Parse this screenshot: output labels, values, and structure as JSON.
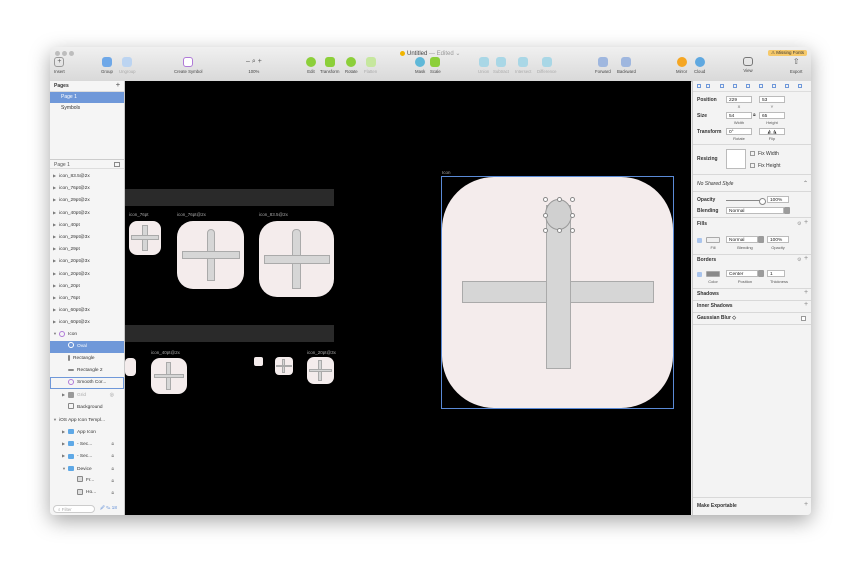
{
  "window": {
    "title": "Untitled",
    "title_suffix": "— Edited ⌄",
    "missing_fonts": "⚠ Missing Fonts"
  },
  "toolbar": [
    {
      "id": "insert",
      "label": "Insert",
      "icon": "plus-icon"
    },
    {
      "id": "group",
      "label": "Group",
      "icon": "group-icon"
    },
    {
      "id": "ungroup",
      "label": "Ungroup",
      "icon": "ungroup-icon"
    },
    {
      "id": "create_symbol",
      "label": "Create Symbol",
      "icon": "symbol-icon"
    },
    {
      "id": "zoom",
      "label": "100%",
      "icon": "magnifier-icon",
      "glyph": "– 🔍 +"
    },
    {
      "id": "edit",
      "label": "Edit",
      "icon": "edit-icon"
    },
    {
      "id": "transform",
      "label": "Transform",
      "icon": "transform-icon"
    },
    {
      "id": "rotate",
      "label": "Rotate",
      "icon": "rotate-icon"
    },
    {
      "id": "flatten",
      "label": "Flatten",
      "icon": "flatten-icon"
    },
    {
      "id": "mask",
      "label": "Mask",
      "icon": "mask-icon"
    },
    {
      "id": "scale",
      "label": "Scale",
      "icon": "scale-icon"
    },
    {
      "id": "union",
      "label": "Union",
      "icon": "union-icon"
    },
    {
      "id": "subtract",
      "label": "Subtract",
      "icon": "subtract-icon"
    },
    {
      "id": "intersect",
      "label": "Intersect",
      "icon": "intersect-icon"
    },
    {
      "id": "difference",
      "label": "Difference",
      "icon": "difference-icon"
    },
    {
      "id": "forward",
      "label": "Forward",
      "icon": "forward-icon"
    },
    {
      "id": "backward",
      "label": "Backward",
      "icon": "backward-icon"
    },
    {
      "id": "mirror",
      "label": "Mirror",
      "icon": "mirror-icon"
    },
    {
      "id": "cloud",
      "label": "Cloud",
      "icon": "cloud-icon"
    },
    {
      "id": "view",
      "label": "View",
      "icon": "view-icon"
    },
    {
      "id": "export",
      "label": "Export",
      "icon": "export-icon"
    }
  ],
  "sidebar": {
    "pages_title": "Pages",
    "pages": [
      "Page 1",
      "Symbols"
    ],
    "selected_page": "Page 1",
    "layers_title": "Page 1",
    "layers": [
      {
        "label": "icon_83.5@2x",
        "type": "artboard"
      },
      {
        "label": "icon_76pt@2x",
        "type": "artboard"
      },
      {
        "label": "icon_29pt@2x",
        "type": "artboard"
      },
      {
        "label": "icon_40pt@2x",
        "type": "artboard"
      },
      {
        "label": "icon_40pt",
        "type": "artboard"
      },
      {
        "label": "icon_29pt@3x",
        "type": "artboard"
      },
      {
        "label": "icon_29pt",
        "type": "artboard"
      },
      {
        "label": "icon_20pt@3x",
        "type": "artboard"
      },
      {
        "label": "icon_20pt@2x",
        "type": "artboard"
      },
      {
        "label": "icon_20pt",
        "type": "artboard"
      },
      {
        "label": "icon_76pt",
        "type": "artboard"
      },
      {
        "label": "icon_60pt@3x",
        "type": "artboard"
      },
      {
        "label": "icon_60pt@2x",
        "type": "artboard"
      },
      {
        "label": "Icon",
        "type": "symbol-open"
      },
      {
        "label": "Oval",
        "type": "oval",
        "selected": true
      },
      {
        "label": "Rectangle",
        "type": "rect-v"
      },
      {
        "label": "Rectangle 2",
        "type": "rect-h"
      },
      {
        "label": "Smooth Cor...",
        "type": "smooth",
        "boxed": true
      },
      {
        "label": "Grid",
        "type": "grid",
        "dim": true
      },
      {
        "label": "Background",
        "type": "bg"
      },
      {
        "label": "iOS App Icon Templ...",
        "type": "group-open"
      },
      {
        "label": "App Icon",
        "type": "folder"
      },
      {
        "label": "- Sec...",
        "type": "folder",
        "locked": true
      },
      {
        "label": "- Sec...",
        "type": "folder",
        "locked": true
      },
      {
        "label": "Device",
        "type": "folder-open",
        "locked": true
      },
      {
        "label": "Fr...",
        "type": "image",
        "locked": true
      },
      {
        "label": "Ho...",
        "type": "image",
        "locked": true
      }
    ],
    "filter_placeholder": "Filter",
    "filter_count": "🖉 ✎ 18"
  },
  "canvas": {
    "labels": {
      "icon_76pt": "icon_76pt",
      "icon_76pt_2x": "icon_76pt@2x",
      "icon_83_5_2x": "icon_83.5@2x",
      "icon_40pt_2x": "icon_40pt@2x",
      "icon_20pt_3x": "icon_20pt@3x",
      "main": "Icon"
    }
  },
  "inspector": {
    "position_label": "Position",
    "x": "229",
    "y": "53",
    "x_label": "X",
    "y_label": "Y",
    "size_label": "Size",
    "width": "54",
    "height": "65",
    "width_label": "Width",
    "height_label": "Height",
    "transform_label": "Transform",
    "rotate": "0°",
    "rotate_label": "Rotate",
    "flip_label": "Flip",
    "resizing_label": "Resizing",
    "fix_width": "Fix Width",
    "fix_height": "Fix Height",
    "shared_style": "No Shared Style",
    "opacity_label": "Opacity",
    "opacity_value": "100%",
    "blending_label": "Blending",
    "blending_value": "Normal",
    "fills_label": "Fills",
    "fill_blend": "Normal",
    "fill_opacity": "100%",
    "fill_sub": "Fill",
    "blending_sub": "Blending",
    "opacity_sub": "Opacity",
    "borders_label": "Borders",
    "border_position": "Center",
    "border_thickness": "1",
    "color_sub": "Color",
    "position_sub": "Position",
    "thickness_sub": "Thickness",
    "shadows_label": "Shadows",
    "inner_shadows_label": "Inner Shadows",
    "gaussian_label": "Gaussian Blur ◇",
    "make_exportable": "Make Exportable"
  },
  "colors": {
    "selection": "#6f98d9",
    "canvas": "#000000",
    "icon_bg": "#f4ecec",
    "accent_warning": "#f6c96a"
  }
}
